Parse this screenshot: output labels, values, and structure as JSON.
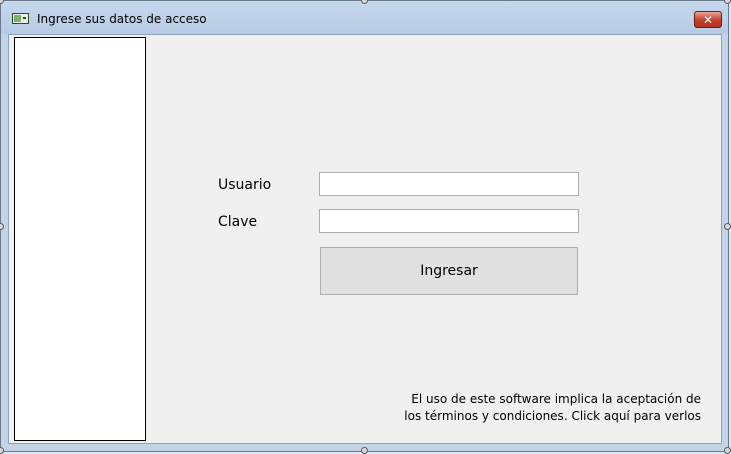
{
  "window": {
    "title": "Ingrese sus datos de acceso",
    "close_symbol": "✕"
  },
  "form": {
    "user_label": "Usuario",
    "user_value": "",
    "password_label": "Clave",
    "password_value": "",
    "submit_label": "Ingresar"
  },
  "terms": {
    "line1": "El uso de este software implica la aceptación de",
    "line2": "los términos y condiciones. Click aquí para verlos"
  },
  "icons": {
    "app": "app-window-icon",
    "close": "close-icon"
  },
  "colors": {
    "titlebar": "#c5d8ee",
    "client_background": "#f0f0f0",
    "close_button": "#c7402a"
  }
}
